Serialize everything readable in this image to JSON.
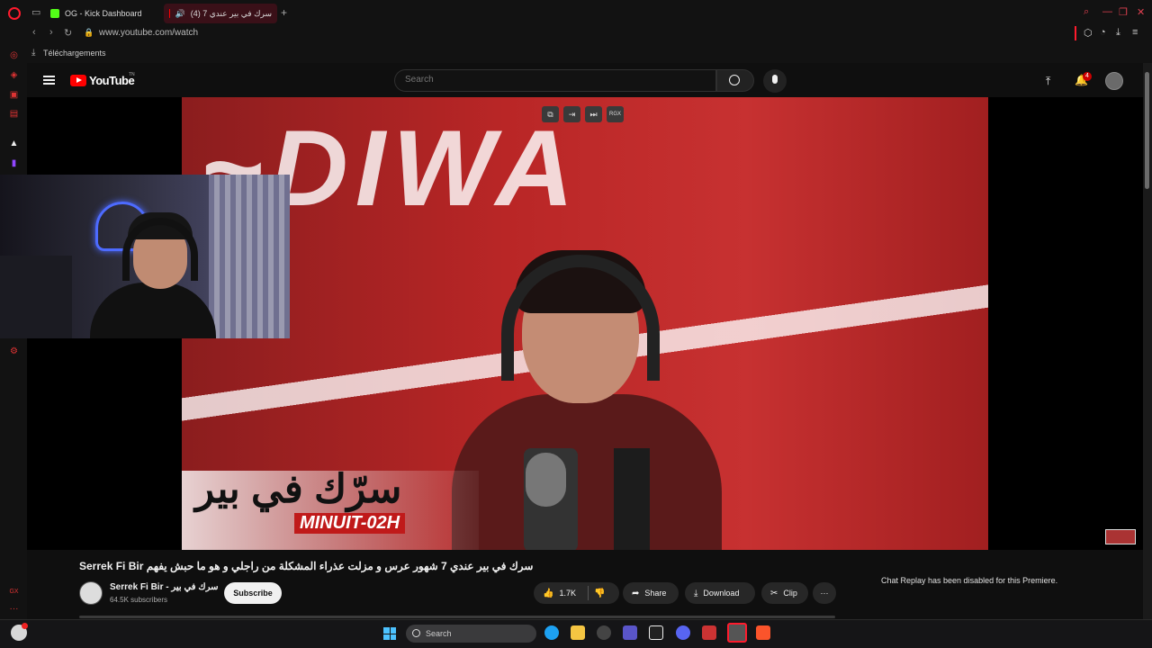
{
  "browser": {
    "tabs": [
      {
        "label": "OG - Kick Dashboard"
      },
      {
        "label": "(4) سرك في بير عندي 7"
      }
    ],
    "url": "www.youtube.com/watch",
    "downloads_label": "Téléchargements"
  },
  "youtube": {
    "logo_text": "YouTube",
    "logo_region": "TN",
    "search_placeholder": "Search",
    "notification_count": "4"
  },
  "player": {
    "overlay_buttons": [
      "⧉",
      "⇥",
      "⏭",
      "RGX"
    ],
    "lower_third_arabic": "سرّك في بير",
    "lower_third_sub": "MINUIT-02H"
  },
  "video": {
    "title": "Serrek Fi Bir سرك في بير عندي 7 شهور عرس و مزلت عذراء المشكلة من راجلي و هو ما حبش يفهم",
    "channel_name": "Serrek Fi Bir - سرك في بير",
    "subscribers": "64.5K subscribers",
    "subscribe_label": "Subscribe",
    "like_count": "1.7K",
    "share_label": "Share",
    "download_label": "Download",
    "clip_label": "Clip",
    "more_label": "···"
  },
  "chat": {
    "replay_message": "Chat Replay has been disabled for this Premiere."
  },
  "taskbar": {
    "search_placeholder": "Search"
  },
  "colors": {
    "opera_red": "#ff1b2d",
    "yt_red": "#ff0000",
    "background": "#0f0f0f"
  }
}
